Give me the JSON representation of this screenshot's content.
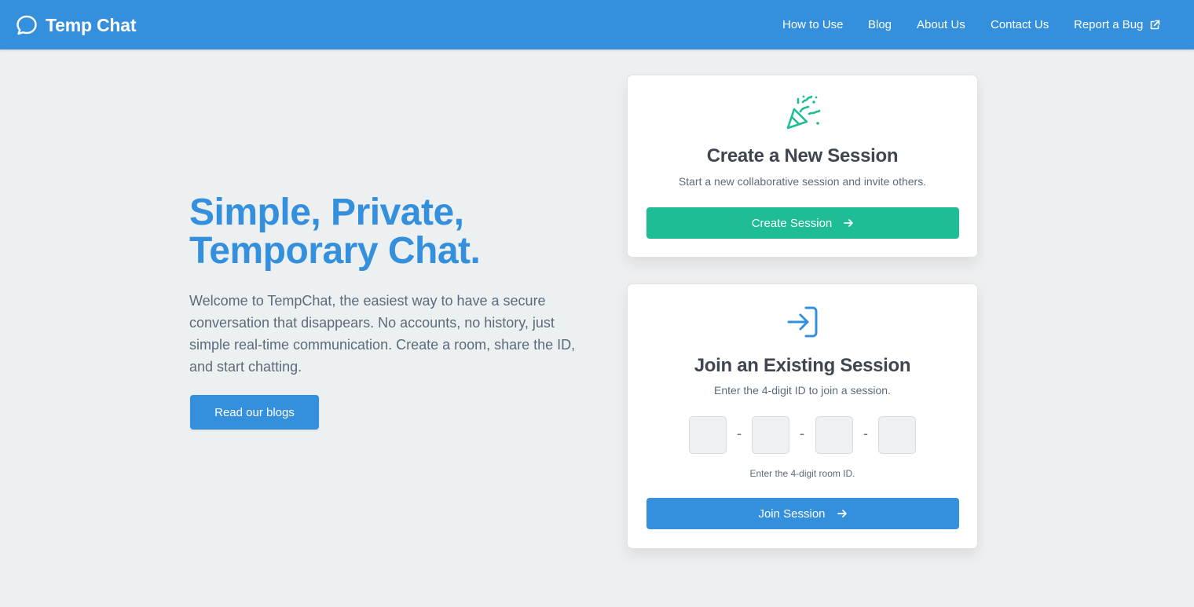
{
  "header": {
    "brand": "Temp Chat",
    "nav": {
      "how_to_use": "How to Use",
      "blog": "Blog",
      "about": "About Us",
      "contact": "Contact Us",
      "report_bug": "Report a Bug"
    }
  },
  "hero": {
    "title_line1": "Simple, Private,",
    "title_line2": "Temporary Chat.",
    "description": "Welcome to TempChat, the easiest way to have a secure conversation that disappears. No accounts, no history, just simple real-time communication. Create a room, share the ID, and start chatting.",
    "blog_button": "Read our blogs"
  },
  "create_card": {
    "icon": "party-popper-icon",
    "title": "Create a New Session",
    "subtitle": "Start a new collaborative session and invite others.",
    "button": "Create Session"
  },
  "join_card": {
    "icon": "sign-in-icon",
    "title": "Join an Existing Session",
    "subtitle": "Enter the 4-digit ID to join a session.",
    "digits": [
      "",
      "",
      "",
      ""
    ],
    "separator": "-",
    "hint": "Enter the 4-digit room ID.",
    "button": "Join Session"
  },
  "colors": {
    "primary": "#3490dc",
    "accent_green": "#1fbd96",
    "background": "#edf0f1"
  }
}
